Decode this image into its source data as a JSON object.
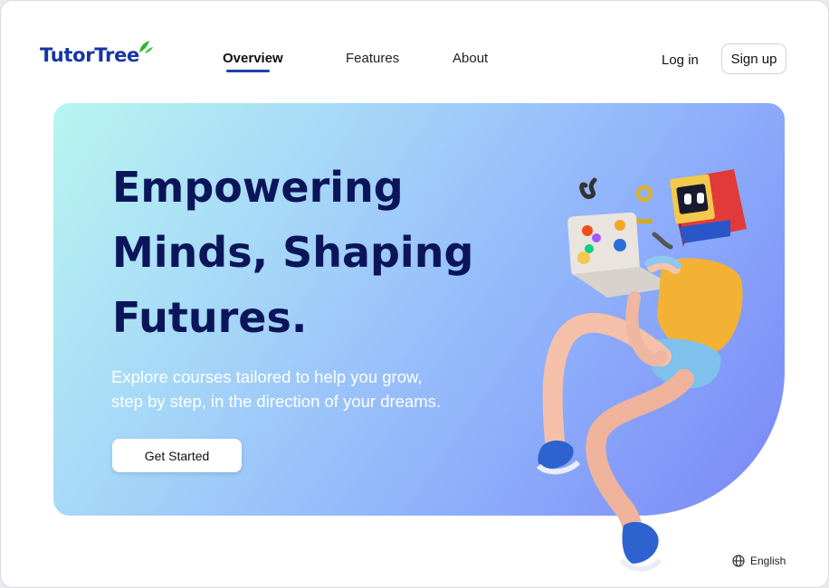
{
  "brand": {
    "name": "TutorTree",
    "accent": "#1636a6",
    "leaf_color": "#2fb52f"
  },
  "nav": {
    "items": [
      {
        "label": "Overview",
        "active": true
      },
      {
        "label": "Features",
        "active": false
      },
      {
        "label": "About",
        "active": false
      }
    ]
  },
  "auth": {
    "login_label": "Log in",
    "signup_label": "Sign up"
  },
  "hero": {
    "title_lines": [
      "Empowering",
      "Minds, Shaping",
      "Futures."
    ],
    "subtitle_lines": [
      "Explore courses tailored to help you grow,",
      "step by step, in the direction of your dreams."
    ],
    "cta_label": "Get Started",
    "illustration": "3d-character-with-laptop-icon",
    "gradient_colors": [
      "#b8f5f0",
      "#a6d8f8",
      "#8fb0fb",
      "#7a88f7"
    ]
  },
  "footer": {
    "language_label": "English",
    "language_icon": "globe-icon"
  }
}
